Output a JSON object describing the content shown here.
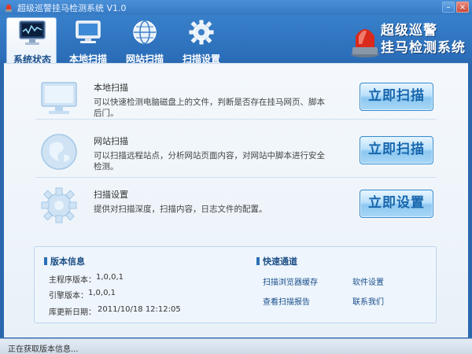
{
  "window": {
    "title": "超级巡警挂马检测系统 V1.0"
  },
  "title_buttons": {
    "minimize": "–",
    "close": "×"
  },
  "tabs": [
    {
      "label": "系统状态",
      "icon": "monitor-chart-icon",
      "active": true
    },
    {
      "label": "本地扫描",
      "icon": "computer-icon",
      "active": false
    },
    {
      "label": "网站扫描",
      "icon": "globe-icon",
      "active": false
    },
    {
      "label": "扫描设置",
      "icon": "gear-icon",
      "active": false
    }
  ],
  "brand": {
    "line1": "超级巡警",
    "line2": "挂马检测系统",
    "icon": "siren-icon"
  },
  "actions": [
    {
      "title": "本地扫描",
      "desc": "可以快速检测电脑磁盘上的文件，判断是否存在挂马网页、脚本后门。",
      "button": "立即扫描",
      "icon": "monitor-icon"
    },
    {
      "title": "网站扫描",
      "desc": "可以扫描远程站点，分析网站页面内容，对网站中脚本进行安全检测。",
      "button": "立即扫描",
      "icon": "globe-icon"
    },
    {
      "title": "扫描设置",
      "desc": "提供对扫描深度，扫描内容，日志文件的配置。",
      "button": "立即设置",
      "icon": "gear-icon"
    }
  ],
  "version_info": {
    "heading": "版本信息",
    "rows": [
      {
        "key": "主程序版本：",
        "value": "1,0,0,1"
      },
      {
        "key": "引擎版本：",
        "value": "1,0,0,1"
      },
      {
        "key": "库更新日期：",
        "value": "2011/10/18 12:12:05"
      }
    ]
  },
  "quick_links": {
    "heading": "快速通道",
    "links": [
      "扫描浏览器缓存",
      "软件设置",
      "查看扫描报告",
      "联系我们"
    ]
  },
  "status": {
    "text": "正在获取版本信息..."
  },
  "colors": {
    "accent": "#2b6db8",
    "button_text": "#1766ad"
  }
}
